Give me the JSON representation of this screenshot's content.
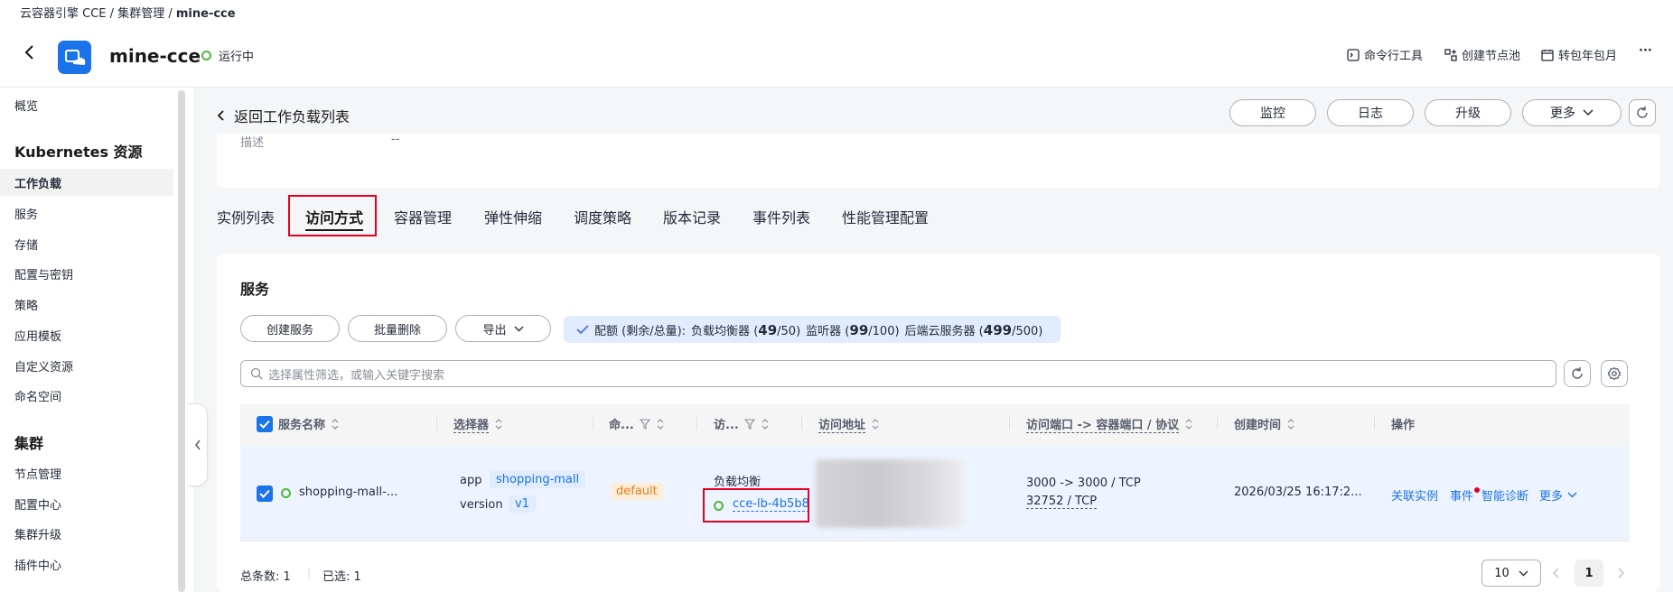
{
  "breadcrumb": {
    "part1": "云容器引擎 CCE",
    "sep": "/",
    "part2": "集群管理",
    "part3": "mine-cce"
  },
  "cluster": {
    "name": "mine-cce",
    "status": "运行中"
  },
  "toolbar": {
    "cli": "命令行工具",
    "create_nodepool": "创建节点池",
    "convert": "转包年包月",
    "more": "···"
  },
  "sidebar": {
    "overview": "概览",
    "k8s_section": "Kubernetes 资源",
    "k8s_items": [
      "工作负载",
      "服务",
      "存储",
      "配置与密钥",
      "策略",
      "应用模板",
      "自定义资源",
      "命名空间"
    ],
    "cluster_section": "集群",
    "cluster_items": [
      "节点管理",
      "配置中心",
      "集群升级",
      "插件中心"
    ],
    "active_item": "工作负载"
  },
  "page": {
    "back_label": "返回工作负载列表",
    "actions": {
      "monitor": "监控",
      "logs": "日志",
      "upgrade": "升级",
      "more": "更多"
    },
    "info": {
      "label": "描述",
      "value": "--"
    }
  },
  "tabs": [
    "实例列表",
    "访问方式",
    "容器管理",
    "弹性伸缩",
    "调度策略",
    "版本记录",
    "事件列表",
    "性能管理配置"
  ],
  "active_tab": "访问方式",
  "services": {
    "title": "服务",
    "buttons": {
      "create": "创建服务",
      "batch_delete": "批量删除",
      "export": "导出"
    },
    "quota": {
      "label": "配额 (剩余/总量):",
      "lb_label": "负载均衡器",
      "lb_used": "49",
      "lb_total": "/50)",
      "listener_label": "监听器",
      "listener_used": "99",
      "listener_total": "/100)",
      "backend_label": "后端云服务器",
      "backend_used": "499",
      "backend_total": "/500)"
    },
    "search_placeholder": "选择属性筛选，或输入关键字搜索",
    "columns": {
      "name": "服务名称",
      "selector": "选择器",
      "namespace": "命...",
      "access": "访...",
      "address": "访问地址",
      "ports": "访问端口 -> 容器端口 / 协议",
      "created": "创建时间",
      "ops": "操作"
    },
    "rows": [
      {
        "name": "shopping-mall-...",
        "selector": [
          {
            "key": "app",
            "value": "shopping-mall"
          },
          {
            "key": "version",
            "value": "v1"
          }
        ],
        "namespace": "default",
        "access_type": "负载均衡",
        "lb_name": "cce-lb-4b5b8",
        "port_line1": "3000 -> 3000 / TCP",
        "port_line2": "32752 / TCP",
        "created": "2026/03/25 16:17:2...",
        "ops": {
          "link1": "关联实例",
          "link2": "事件",
          "link3": "智能诊断",
          "more": "更多"
        }
      }
    ],
    "footer": {
      "total_label": "总条数:",
      "total": "1",
      "selected_label": "已选:",
      "selected": "1",
      "page_size": "10",
      "page": "1"
    }
  },
  "colors": {
    "primary": "#1a73e8",
    "running": "#50b83c",
    "highlight_border": "#e6001f",
    "tag_orange": "#e37d1d"
  }
}
